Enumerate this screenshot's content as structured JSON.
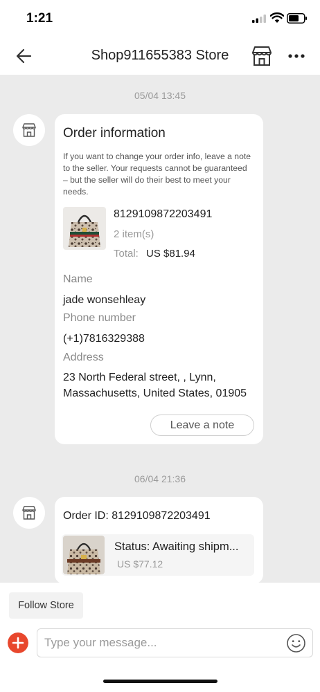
{
  "status_bar": {
    "time": "1:21"
  },
  "header": {
    "title": "Shop911655383 Store",
    "icons": [
      "back-arrow-icon",
      "store-icon",
      "more-icon"
    ]
  },
  "messages": [
    {
      "timestamp": "05/04 13:45",
      "card": {
        "title": "Order information",
        "note": "If you want to change your order info, leave a note to the seller. Your requests cannot be guaranteed – but the seller will do their best to meet your needs.",
        "order_number": "8129109872203491",
        "items": "2 item(s)",
        "total_label": "Total:",
        "total_value": "US $81.94",
        "fields": [
          {
            "label": "Name",
            "value": "jade wonsehleay"
          },
          {
            "label": "Phone number",
            "value": "(+1)7816329388"
          },
          {
            "label": "Address",
            "value": "23 North Federal street, , Lynn, Massachusetts, United States, 01905"
          }
        ],
        "leave_note_label": "Leave a note"
      }
    },
    {
      "timestamp": "06/04 21:36",
      "card": {
        "order_id": "Order ID: 8129109872203491",
        "status": "Status:  Awaiting shipm...",
        "price": "US $77.12"
      }
    }
  ],
  "footer": {
    "follow_label": "Follow Store",
    "input_placeholder": "Type your message..."
  },
  "colors": {
    "accent": "#e8472d",
    "background": "#ebebeb",
    "card": "#ffffff"
  }
}
